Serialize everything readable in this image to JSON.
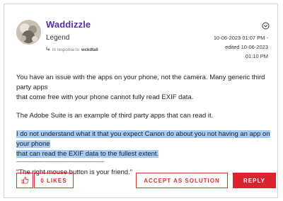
{
  "post": {
    "author": "Waddizzle",
    "rank": "Legend",
    "in_response_prefix": "In response to",
    "in_response_user": "wckdtall",
    "date_line1": "10-06-2023 01:07 PM -",
    "date_line2": "edited 10-06-2023",
    "date_line3": "01:10 PM",
    "para1_line1": "You have an issue with the apps on your phone, not the camera.  Many generic third party apps",
    "para1_line2": "that come free with your phone cannot fully read EXIF data.",
    "para2": "The Adobe Suite is an example of third party apps that can read it.",
    "para3_line1": "I do not understand what it that you expect Canon do about you not having an app on your phone",
    "para3_line2": "that can read the EXIF data to the fullest extent.",
    "divider": "-------------------------------------------------------------",
    "signature": "\"The right mouse button is your friend.\""
  },
  "actions": {
    "likes_label": "0 LIKES",
    "accept_label": "ACCEPT AS SOLUTION",
    "reply_label": "REPLY"
  },
  "colors": {
    "accent": "#d9232e",
    "username": "#5a2ea6",
    "highlight": "#a8cdf5"
  }
}
